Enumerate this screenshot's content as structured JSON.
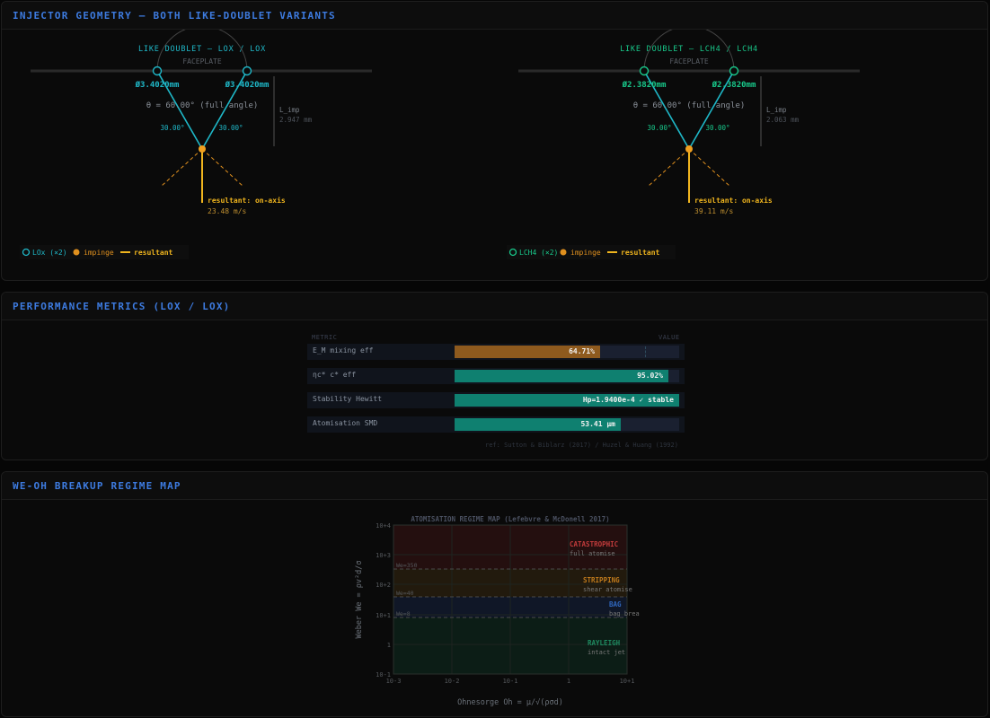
{
  "panels": {
    "geometry": {
      "title": "INJECTOR GEOMETRY — BOTH LIKE-DOUBLET VARIANTS"
    },
    "performance": {
      "title": "PERFORMANCE METRICS (LOX / LOX)"
    },
    "regime": {
      "title": "WE-OH BREAKUP REGIME MAP"
    }
  },
  "variants": [
    {
      "title": "LIKE DOUBLET — LOX / LOX",
      "faceplate": "FACEPLATE",
      "d_left": "Ø3.4020mm",
      "d_right": "Ø3.4020mm",
      "theta": "θ = 60.00° (full angle)",
      "half_left": "30.00°",
      "half_right": "30.00°",
      "limp_label": "L_imp",
      "limp_value": "2.947 mm",
      "resultant": "resultant: on-axis",
      "velocity": "23.48 m/s",
      "legend_orifice": "LOx (×2)",
      "legend_impinge": "impinge",
      "legend_resultant": "resultant",
      "color": "#1fb8c8"
    },
    {
      "title": "LIKE DOUBLET — LCH4 / LCH4",
      "faceplate": "FACEPLATE",
      "d_left": "Ø2.3820mm",
      "d_right": "Ø2.3820mm",
      "theta": "θ = 60.00° (full angle)",
      "half_left": "30.00°",
      "half_right": "30.00°",
      "limp_label": "L_imp",
      "limp_value": "2.063 mm",
      "resultant": "resultant: on-axis",
      "velocity": "39.11 m/s",
      "legend_orifice": "LCH4 (×2)",
      "legend_impinge": "impinge",
      "legend_resultant": "resultant",
      "color": "#18c88a"
    }
  ],
  "metrics": {
    "header_metric": "METRIC",
    "header_value": "VALUE",
    "rows": [
      {
        "label": "E_M  mixing eff",
        "value": "64.71%",
        "fraction": 0.6471,
        "color": "#8e5a1e"
      },
      {
        "label": "ηc*  c* eff",
        "value": "95.02%",
        "fraction": 0.9502,
        "color": "#0f8070"
      },
      {
        "label": "Stability  Hewitt",
        "value": "Hp=1.9400e-4  ✓ stable",
        "fraction": 1.0,
        "color": "#0f8070"
      },
      {
        "label": "Atomisation  SMD",
        "value": "53.41 μm",
        "fraction": 0.74,
        "color": "#0f8070"
      }
    ],
    "reference": "ref: Sutton & Biblarz (2017) / Huzel & Huang (1992)"
  },
  "regime_map": {
    "title": "ATOMISATION REGIME MAP  (Lefebvre & McDonell 2017)",
    "ylabel": "Weber  We = ρv²d/σ",
    "xlabel": "Ohnesorge  Oh = μ/√(ρσd)",
    "y_ticks": [
      "10+4",
      "10+3",
      "10+2",
      "10+1",
      "1",
      "10-1"
    ],
    "x_ticks": [
      "10-3",
      "10-2",
      "10-1",
      "1",
      "10+1"
    ],
    "thresholds": [
      "We=350",
      "We=40",
      "We=8"
    ],
    "regions": [
      {
        "name": "CATASTROPHIC",
        "desc": "full atomise",
        "color": "#c23b3b"
      },
      {
        "name": "STRIPPING",
        "desc": "shear atomise",
        "color": "#c07a1c"
      },
      {
        "name": "BAG",
        "desc": "bag brea",
        "color": "#3068c0"
      },
      {
        "name": "RAYLEIGH",
        "desc": "intact jet",
        "color": "#1e8a60"
      }
    ]
  }
}
